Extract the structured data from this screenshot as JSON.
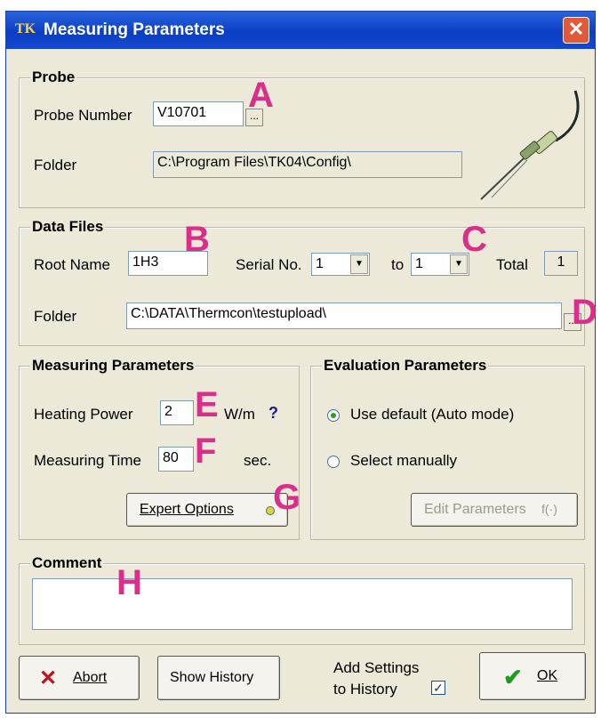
{
  "window": {
    "title": "Measuring Parameters",
    "app_icon": "TK",
    "close_glyph": "✕"
  },
  "probe": {
    "group_title": "Probe",
    "number_label": "Probe Number",
    "number_value": "V10701",
    "browse_glyph": "...",
    "folder_label": "Folder",
    "folder_value": "C:\\Program Files\\TK04\\Config\\"
  },
  "data_files": {
    "group_title": "Data Files",
    "root_name_label": "Root Name",
    "root_name_value": "1H3",
    "serial_label": "Serial No.",
    "serial_from": "1",
    "to_label": "to",
    "serial_to": "1",
    "total_label": "Total",
    "total_value": "1",
    "folder_label": "Folder",
    "folder_value": "C:\\DATA\\Thermcon\\testupload\\",
    "browse_glyph": "..."
  },
  "measuring": {
    "group_title": "Measuring Parameters",
    "heating_label": "Heating Power",
    "heating_value": "2",
    "heating_unit": "W/m",
    "help_glyph": "?",
    "time_label": "Measuring Time",
    "time_value": "80",
    "time_unit": "sec.",
    "expert_button": "Expert Options"
  },
  "evaluation": {
    "group_title": "Evaluation Parameters",
    "option_auto": "Use default (Auto mode)",
    "option_manual": "Select manually",
    "selected": "auto",
    "edit_button": "Edit Parameters",
    "edit_icon_glyph": "f(·)"
  },
  "comment": {
    "group_title": "Comment",
    "value": ""
  },
  "footer": {
    "abort_button": "Abort",
    "history_button": "Show History",
    "add_settings_line1": "Add Settings",
    "add_settings_line2": "to History",
    "add_settings_checked": true,
    "ok_button": "OK"
  },
  "annotations": [
    "A",
    "B",
    "C",
    "D",
    "E",
    "F",
    "G",
    "H"
  ],
  "colors": {
    "title_bar": "#0a3fc5",
    "dialog_bg": "#ece9d8",
    "annotation": "#d92f8a",
    "ok_check": "#1e9a1e",
    "abort_x": "#c0121c"
  }
}
